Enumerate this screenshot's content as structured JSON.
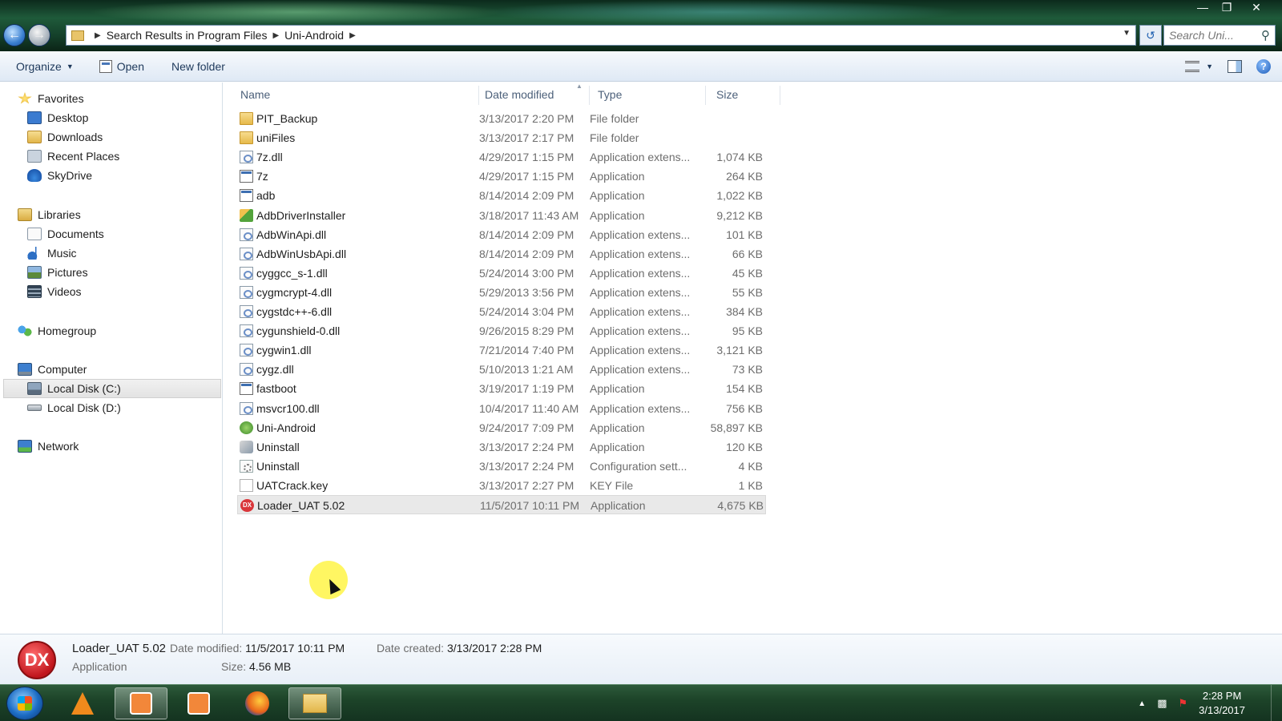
{
  "window": {
    "address": [
      "Search Results in Program Files",
      "Uni-Android"
    ],
    "search_placeholder": "Search Uni...",
    "controls": {
      "minimize": "—",
      "maximize": "❐",
      "close": "✕"
    }
  },
  "toolbar": {
    "organize": "Organize",
    "open": "Open",
    "new_folder": "New folder"
  },
  "nav": {
    "favorites": {
      "label": "Favorites",
      "items": [
        "Desktop",
        "Downloads",
        "Recent Places",
        "SkyDrive"
      ]
    },
    "libraries": {
      "label": "Libraries",
      "items": [
        "Documents",
        "Music",
        "Pictures",
        "Videos"
      ]
    },
    "homegroup": "Homegroup",
    "computer": {
      "label": "Computer",
      "items": [
        "Local Disk (C:)",
        "Local Disk (D:)"
      ],
      "selected": "Local Disk (C:)"
    },
    "network": "Network"
  },
  "columns": {
    "name": "Name",
    "date": "Date modified",
    "type": "Type",
    "size": "Size"
  },
  "files": [
    {
      "name": "PIT_Backup",
      "date": "3/13/2017 2:20 PM",
      "type": "File folder",
      "size": "",
      "icon": "folder-icon"
    },
    {
      "name": "uniFiles",
      "date": "3/13/2017 2:17 PM",
      "type": "File folder",
      "size": "",
      "icon": "folder-icon"
    },
    {
      "name": "7z.dll",
      "date": "4/29/2017 1:15 PM",
      "type": "Application extens...",
      "size": "1,074 KB",
      "icon": "dll-icon"
    },
    {
      "name": "7z",
      "date": "4/29/2017 1:15 PM",
      "type": "Application",
      "size": "264 KB",
      "icon": "app-icon"
    },
    {
      "name": "adb",
      "date": "8/14/2014 2:09 PM",
      "type": "Application",
      "size": "1,022 KB",
      "icon": "app-icon"
    },
    {
      "name": "AdbDriverInstaller",
      "date": "3/18/2017 11:43 AM",
      "type": "Application",
      "size": "9,212 KB",
      "icon": "installer-icon"
    },
    {
      "name": "AdbWinApi.dll",
      "date": "8/14/2014 2:09 PM",
      "type": "Application extens...",
      "size": "101 KB",
      "icon": "dll-icon"
    },
    {
      "name": "AdbWinUsbApi.dll",
      "date": "8/14/2014 2:09 PM",
      "type": "Application extens...",
      "size": "66 KB",
      "icon": "dll-icon"
    },
    {
      "name": "cyggcc_s-1.dll",
      "date": "5/24/2014 3:00 PM",
      "type": "Application extens...",
      "size": "45 KB",
      "icon": "dll-icon"
    },
    {
      "name": "cygmcrypt-4.dll",
      "date": "5/29/2013 3:56 PM",
      "type": "Application extens...",
      "size": "55 KB",
      "icon": "dll-icon"
    },
    {
      "name": "cygstdc++-6.dll",
      "date": "5/24/2014 3:04 PM",
      "type": "Application extens...",
      "size": "384 KB",
      "icon": "dll-icon"
    },
    {
      "name": "cygunshield-0.dll",
      "date": "9/26/2015 8:29 PM",
      "type": "Application extens...",
      "size": "95 KB",
      "icon": "dll-icon"
    },
    {
      "name": "cygwin1.dll",
      "date": "7/21/2014 7:40 PM",
      "type": "Application extens...",
      "size": "3,121 KB",
      "icon": "dll-icon"
    },
    {
      "name": "cygz.dll",
      "date": "5/10/2013 1:21 AM",
      "type": "Application extens...",
      "size": "73 KB",
      "icon": "dll-icon"
    },
    {
      "name": "fastboot",
      "date": "3/19/2017 1:19 PM",
      "type": "Application",
      "size": "154 KB",
      "icon": "app-icon"
    },
    {
      "name": "msvcr100.dll",
      "date": "10/4/2017 11:40 AM",
      "type": "Application extens...",
      "size": "756 KB",
      "icon": "dll-icon"
    },
    {
      "name": "Uni-Android",
      "date": "9/24/2017 7:09 PM",
      "type": "Application",
      "size": "58,897 KB",
      "icon": "uni-android-icon"
    },
    {
      "name": "Uninstall",
      "date": "3/13/2017 2:24 PM",
      "type": "Application",
      "size": "120 KB",
      "icon": "uninstall-icon"
    },
    {
      "name": "Uninstall",
      "date": "3/13/2017 2:24 PM",
      "type": "Configuration sett...",
      "size": "4 KB",
      "icon": "config-icon"
    },
    {
      "name": "UATCrack.key",
      "date": "3/13/2017 2:27 PM",
      "type": "KEY File",
      "size": "1 KB",
      "icon": "blank-file-icon"
    },
    {
      "name": "Loader_UAT 5.02",
      "date": "11/5/2017 10:11 PM",
      "type": "Application",
      "size": "4,675 KB",
      "icon": "dx-icon",
      "selected": true
    }
  ],
  "details": {
    "icon_text": "DX",
    "name": "Loader_UAT 5.02",
    "type": "Application",
    "date_modified_label": "Date modified:",
    "date_modified": "11/5/2017 10:11 PM",
    "date_created_label": "Date created:",
    "date_created": "3/13/2017 2:28 PM",
    "size_label": "Size:",
    "size": "4.56 MB"
  },
  "taskbar": {
    "apps": [
      "vlc-icon",
      "camera-app-icon",
      "camera-app-icon",
      "firefox-icon",
      "file-explorer-icon"
    ],
    "time": "2:28 PM",
    "date": "3/13/2017"
  },
  "colors": {
    "accent": "#3e6fb1",
    "selected_row": "#e9e9e9",
    "dx_red": "#d9363a"
  }
}
